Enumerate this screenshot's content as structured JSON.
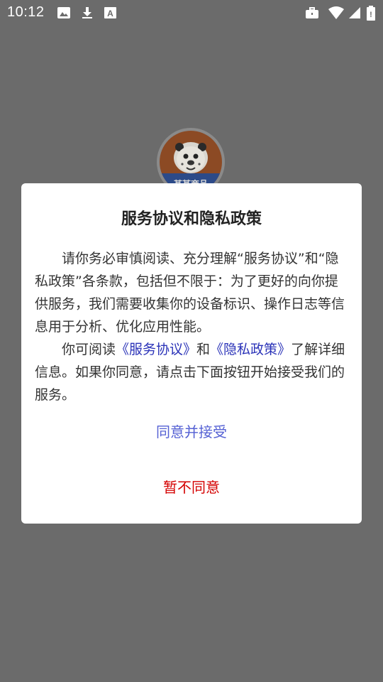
{
  "status_bar": {
    "time": "10:12",
    "left_icons": [
      "image-icon",
      "download-icon",
      "font-icon"
    ],
    "right_icons": [
      "briefcase-icon",
      "wifi-icon",
      "signal-icon",
      "battery-icon"
    ]
  },
  "background": {
    "logo_text": "某某商品"
  },
  "dialog": {
    "title": "服务协议和隐私政策",
    "para1": "请你务必审慎阅读、充分理解“服务协议”和“隐私政策”各条款，包括但不限于：为了更好的向你提供服务，我们需要收集你的设备标识、操作日志等信息用于分析、优化应用性能。",
    "para2_prefix": "你可阅读",
    "service_link": "《服务协议》",
    "para2_and": "和",
    "privacy_link": "《隐私政策》",
    "para2_suffix": "了解详细信息。如果你同意，请点击下面按钮开始接受我们的服务。",
    "agree_label": "同意并接受",
    "decline_label": "暂不同意"
  },
  "colors": {
    "overlay": "#6b6b6b",
    "link": "#2b33b8",
    "agree": "#5561d4",
    "decline": "#d40000"
  }
}
